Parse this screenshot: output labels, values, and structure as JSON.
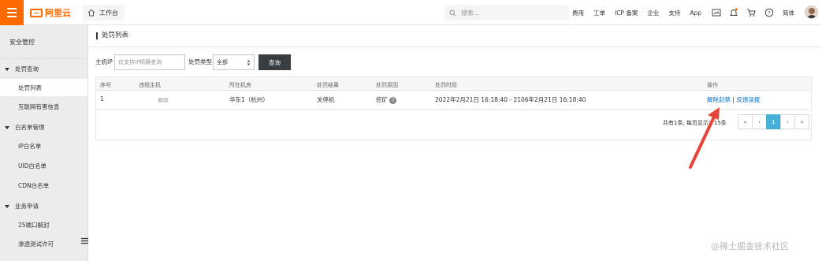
{
  "topbar": {
    "brand": "阿里云",
    "workbench": "工作台",
    "search_placeholder": "搜索...",
    "nav": [
      "费用",
      "工单",
      "ICP 备案",
      "企业",
      "支持",
      "App"
    ],
    "language": "简体",
    "icons": [
      "menu-icon",
      "home-icon",
      "search-icon",
      "screen-icon",
      "bell-icon",
      "cart-icon",
      "help-icon"
    ],
    "accent_color": "#ff6a00"
  },
  "sidebar": {
    "title": "安全管控",
    "groups": [
      {
        "label": "处罚查询",
        "items": [
          "处罚列表",
          "互联网有害信息"
        ]
      },
      {
        "label": "白名单管理",
        "items": [
          "IP白名单",
          "UID白名单",
          "CDN白名单"
        ]
      },
      {
        "label": "业务申请",
        "items": [
          "25端口解封",
          "渗透测试许可"
        ]
      }
    ],
    "active_item": "处罚列表"
  },
  "page": {
    "title": "处罚列表",
    "filter": {
      "ip_label": "主机IP",
      "ip_placeholder": "仅支持IP精确查询",
      "type_label": "处罚类型",
      "type_value": "全部",
      "query_button": "查询"
    },
    "table": {
      "columns": [
        "序号",
        "违规主机",
        "所在机房",
        "处罚结果",
        "处罚原因",
        "处罚时段",
        "操作"
      ],
      "rows": [
        {
          "index": "1",
          "region": "华东1（杭州）",
          "result": "关停机",
          "reason": "挖矿",
          "period": "2022年2月21日 16:18:40 - 2106年2月21日 16:18:40",
          "action_unblock": "解除封禁",
          "action_separator": "|",
          "action_feedback": "反馈误报"
        }
      ]
    },
    "pagination": {
      "summary": "共有1条, 每页显示：15条",
      "buttons": [
        "«",
        "‹",
        "1",
        "›",
        "»"
      ],
      "current": "1"
    }
  },
  "watermark": "@稀土掘金技术社区"
}
